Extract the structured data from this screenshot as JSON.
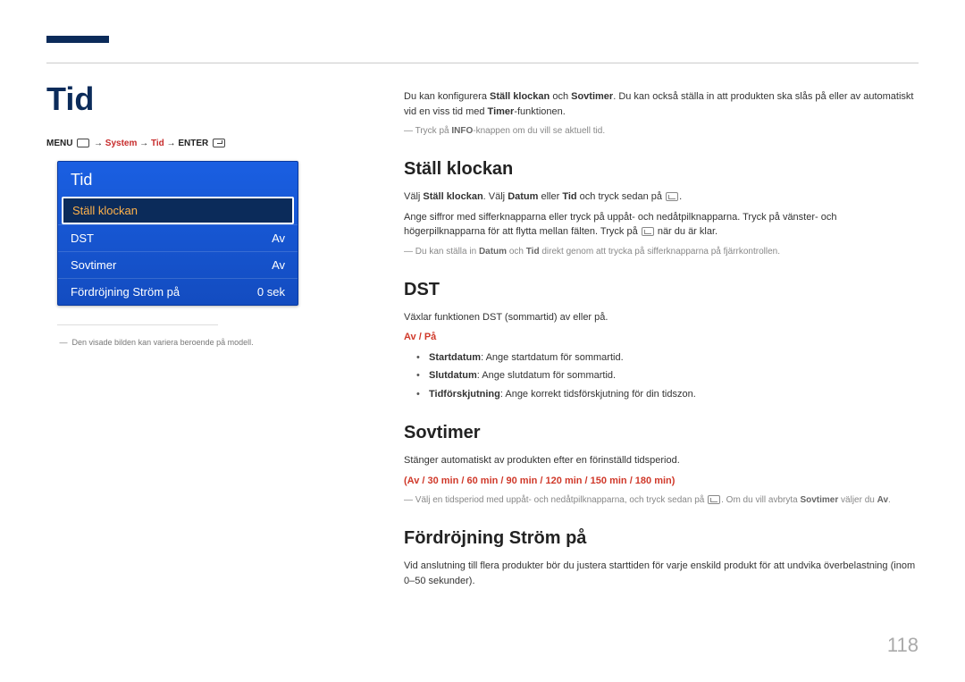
{
  "page_title": "Tid",
  "page_number": "118",
  "breadcrumb": {
    "menu": "MENU",
    "arrow": "→",
    "system": "System",
    "tid": "Tid",
    "enter": "ENTER"
  },
  "panel": {
    "header": "Tid",
    "rows": [
      {
        "label": "Ställ klockan",
        "value": "",
        "selected": true
      },
      {
        "label": "DST",
        "value": "Av",
        "selected": false
      },
      {
        "label": "Sovtimer",
        "value": "Av",
        "selected": false
      },
      {
        "label": "Fördröjning Ström på",
        "value": "0 sek",
        "selected": false
      }
    ],
    "note_dash": "―",
    "note": "Den visade bilden kan variera beroende på modell."
  },
  "intro": {
    "p1a": "Du kan konfigurera ",
    "p1b": "Ställ klockan",
    "p1c": " och ",
    "p1d": "Sovtimer",
    "p1e": ". Du kan också ställa in att produkten ska slås på eller av automatiskt vid en viss tid med ",
    "p1f": "Timer",
    "p1g": "-funktionen.",
    "p2_dash": "―",
    "p2a": "Tryck på ",
    "p2b": "INFO",
    "p2c": "-knappen om du vill se aktuell tid."
  },
  "s1": {
    "h": "Ställ klockan",
    "p1a": "Välj ",
    "p1b": "Ställ klockan",
    "p1c": ". Välj ",
    "p1d": "Datum",
    "p1e": " eller ",
    "p1f": "Tid",
    "p1g": " och tryck sedan på ",
    "p1h": ".",
    "p2": "Ange siffror med sifferknapparna eller tryck på uppåt- och nedåtpilknapparna. Tryck på vänster- och högerpilknapparna för att flytta mellan fälten. Tryck på ",
    "p2b": " när du är klar.",
    "p3_dash": "―",
    "p3a": "Du kan ställa in ",
    "p3b": "Datum",
    "p3c": " och ",
    "p3d": "Tid",
    "p3e": " direkt genom att trycka på sifferknapparna på fjärrkontrollen."
  },
  "s2": {
    "h": "DST",
    "p1": "Växlar funktionen DST (sommartid) av eller på.",
    "opts": {
      "a": "Av",
      "sep": " / ",
      "b": "På"
    },
    "li1a": "Startdatum",
    "li1b": ": Ange startdatum för sommartid.",
    "li2a": "Slutdatum",
    "li2b": ": Ange slutdatum för sommartid.",
    "li3a": "Tidförskjutning",
    "li3b": ": Ange korrekt tidsförskjutning för din tidszon."
  },
  "s3": {
    "h": "Sovtimer",
    "p1": "Stänger automatiskt av produkten efter en förinställd tidsperiod.",
    "opts": "(Av / 30 min / 60 min / 90 min / 120 min / 150 min / 180 min)",
    "p2_dash": "―",
    "p2a": "Välj en tidsperiod med uppåt- och nedåtpilknapparna, och tryck sedan på ",
    "p2b": ". Om du vill avbryta ",
    "p2c": "Sovtimer",
    "p2d": " väljer du ",
    "p2e": "Av",
    "p2f": "."
  },
  "s4": {
    "h": "Fördröjning Ström på",
    "p1": "Vid anslutning till flera produkter bör du justera starttiden för varje enskild produkt för att undvika överbelastning (inom 0–50 sekunder)."
  }
}
